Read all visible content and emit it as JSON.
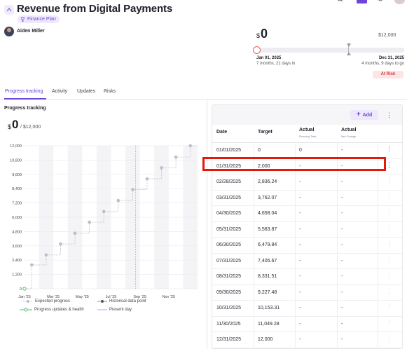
{
  "header": {
    "title": "Revenue from Digital Payments",
    "plan_badge": "Finance Plan",
    "owner": "Aiden Miller"
  },
  "summary": {
    "currency": "$",
    "current": "0",
    "goal": "$12,000",
    "progress_fraction": 0,
    "start_date": "Jan 01, 2025",
    "elapsed": "7 months, 21 days in",
    "end_date": "Dec 31, 2025",
    "remaining": "4 months, 9 days to go",
    "status": "At Risk"
  },
  "tabs": [
    "Progress tracking",
    "Activity",
    "Updates",
    "Risks"
  ],
  "active_tab": "Progress tracking",
  "left_panel": {
    "title": "Progress tracking",
    "currency": "$",
    "current": "0",
    "goal": "/ $12,000"
  },
  "chart_data": {
    "type": "line",
    "y_ticks": [
      "12,000",
      "10,800",
      "9,600",
      "8,400",
      "7,200",
      "6,000",
      "4,800",
      "3,600",
      "2,400",
      "1,200",
      "0"
    ],
    "ylim": [
      0,
      12000
    ],
    "x_ticks": [
      "Jan '25",
      "Mar '25",
      "May '25",
      "Jul '25",
      "Sep '25",
      "Nov '25"
    ],
    "x_tick_months": [
      0,
      2,
      4,
      6,
      8,
      10
    ],
    "present_day_month": 7.7,
    "grid": true,
    "series": [
      {
        "name": "Expected progress",
        "x": [
          1,
          2,
          3,
          4,
          5,
          6,
          7,
          8,
          9,
          10,
          11,
          12
        ],
        "values": [
          2000,
          2836.24,
          3762.07,
          4658.04,
          5583.87,
          6479.84,
          7405.67,
          8331.51,
          9227.48,
          10153.31,
          11049.28,
          12000
        ]
      },
      {
        "name": "Progress updates & health",
        "x": [
          0
        ],
        "values": [
          0
        ]
      }
    ],
    "legend": [
      {
        "label": "Expected progress",
        "icon": "expected-progress"
      },
      {
        "label": "Historical data point",
        "icon": "historical-point"
      },
      {
        "label": "Progress updates & health",
        "icon": "progress-updates"
      },
      {
        "label": "Present day",
        "icon": "present-day"
      }
    ]
  },
  "table": {
    "add_label": "Add",
    "columns": {
      "date": "Date",
      "target": "Target",
      "actual": "Actual",
      "actual_sub": "Running Total",
      "net": "Actual",
      "net_sub": "Net Change"
    },
    "rows": [
      {
        "date": "01/01/2025",
        "target": "0",
        "actual": "0",
        "net": "-"
      },
      {
        "date": "01/31/2025",
        "target": "2,000",
        "actual": "-",
        "net": "-"
      },
      {
        "date": "02/28/2025",
        "target": "2,836.24",
        "actual": "-",
        "net": "-"
      },
      {
        "date": "03/31/2025",
        "target": "3,762.07",
        "actual": "-",
        "net": "-"
      },
      {
        "date": "04/30/2025",
        "target": "4,658.04",
        "actual": "-",
        "net": "-"
      },
      {
        "date": "05/31/2025",
        "target": "5,583.87",
        "actual": "-",
        "net": "-"
      },
      {
        "date": "06/30/2025",
        "target": "6,479.84",
        "actual": "-",
        "net": "-"
      },
      {
        "date": "07/31/2025",
        "target": "7,405.67",
        "actual": "-",
        "net": "-"
      },
      {
        "date": "08/31/2025",
        "target": "8,331.51",
        "actual": "-",
        "net": "-"
      },
      {
        "date": "09/30/2025",
        "target": "9,227.48",
        "actual": "-",
        "net": "-"
      },
      {
        "date": "10/31/2025",
        "target": "10,153.31",
        "actual": "-",
        "net": "-"
      },
      {
        "date": "11/30/2025",
        "target": "11,049.28",
        "actual": "-",
        "net": "-"
      },
      {
        "date": "12/31/2025",
        "target": "12,000",
        "actual": "-",
        "net": "-"
      }
    ],
    "highlighted_row": 1
  },
  "colors": {
    "accent": "#6d45d8",
    "risk": "#d23a35",
    "highlight": "#e8170c",
    "progress_start": "#e8615a"
  }
}
